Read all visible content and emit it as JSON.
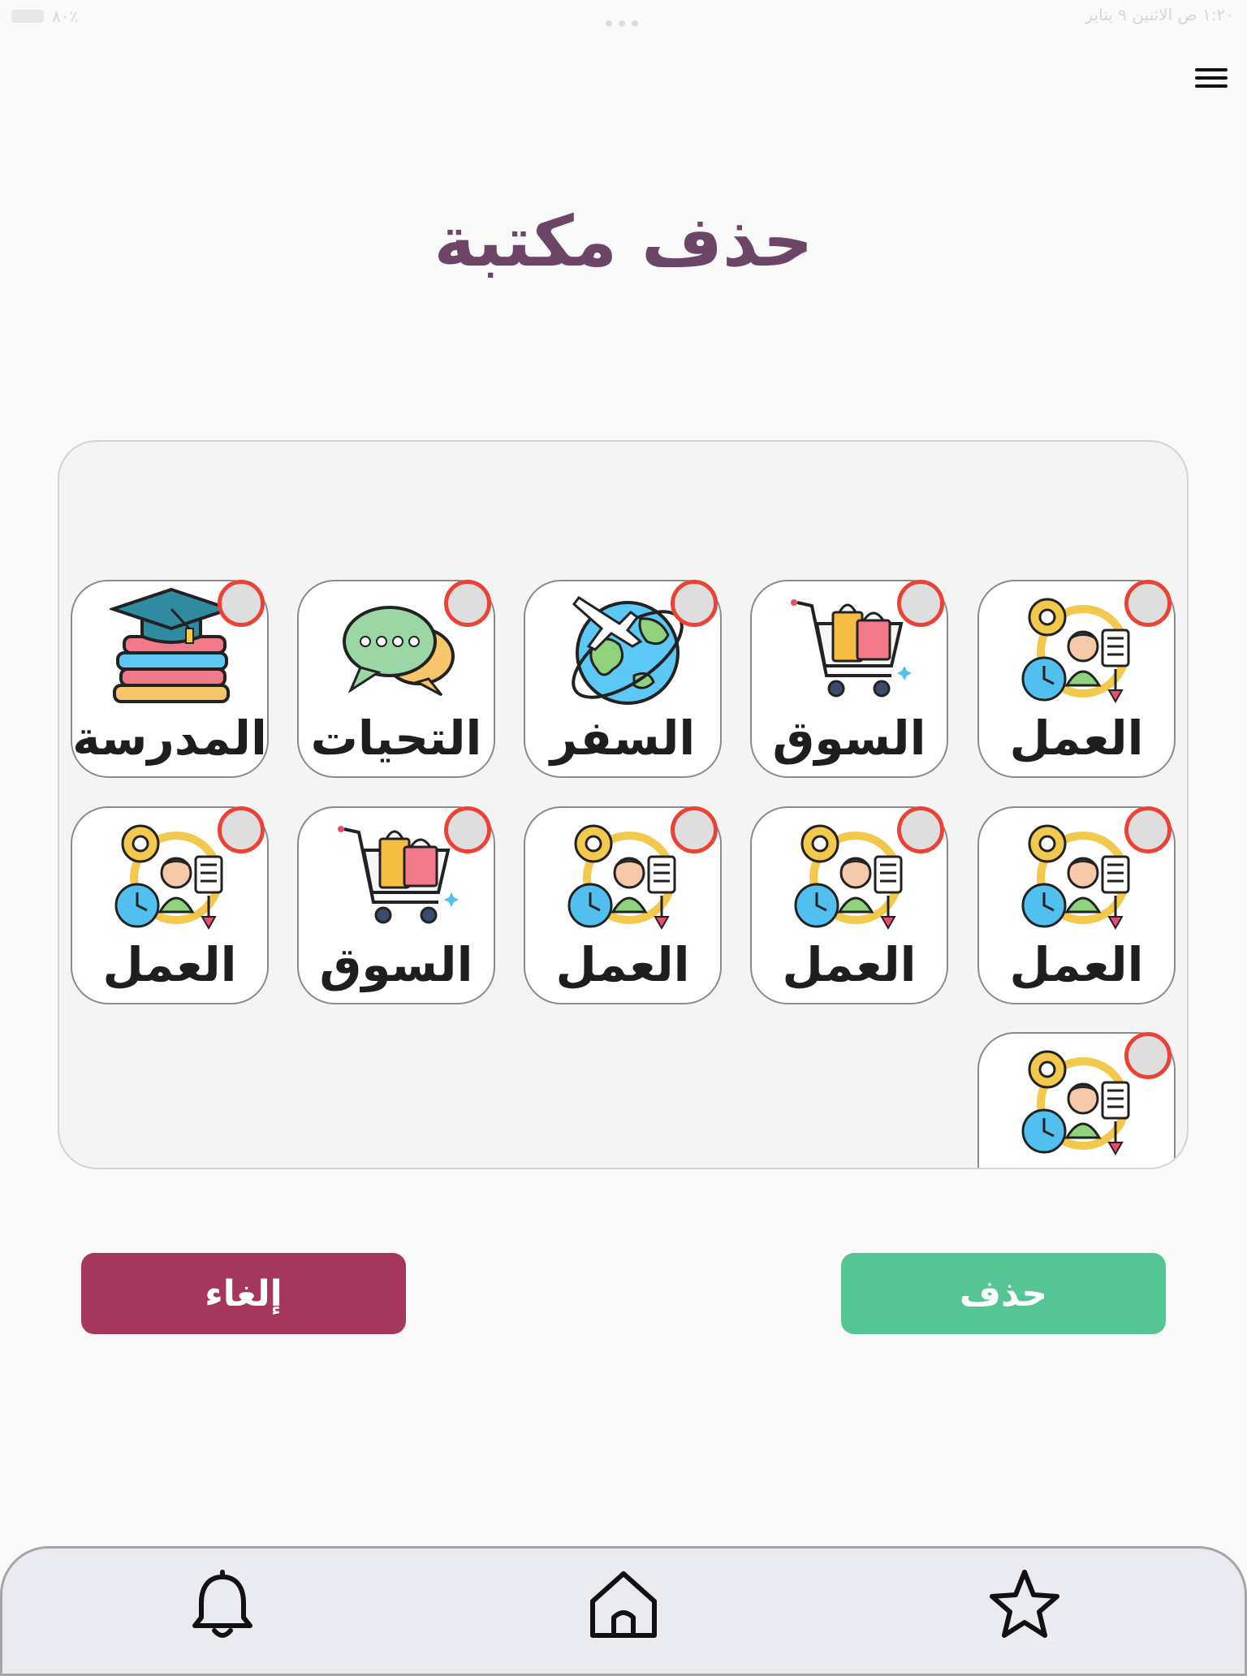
{
  "status_bar": {
    "time_date": "١:٢٠ ص  الاثنين ٩ يناير",
    "battery": "٨٠٪"
  },
  "page": {
    "title": "حذف مكتبة"
  },
  "libraries": [
    {
      "label": "العمل",
      "icon": "work-icon"
    },
    {
      "label": "السوق",
      "icon": "shopping-cart-icon"
    },
    {
      "label": "السفر",
      "icon": "travel-globe-icon"
    },
    {
      "label": "التحيات",
      "icon": "chat-bubbles-icon"
    },
    {
      "label": "المدرسة",
      "icon": "school-books-icon"
    },
    {
      "label": "العمل",
      "icon": "work-icon"
    },
    {
      "label": "العمل",
      "icon": "work-icon"
    },
    {
      "label": "العمل",
      "icon": "work-icon"
    },
    {
      "label": "السوق",
      "icon": "shopping-cart-icon"
    },
    {
      "label": "العمل",
      "icon": "work-icon"
    },
    {
      "label": "",
      "icon": "work-icon"
    }
  ],
  "buttons": {
    "cancel": "إلغاء",
    "delete": "حذف"
  },
  "colors": {
    "title": "#6d4567",
    "cancel": "#a5365e",
    "delete": "#55c596",
    "select_ring": "#ea4335"
  },
  "tab_bar": {
    "items": [
      "bell-icon",
      "home-icon",
      "star-icon"
    ]
  }
}
